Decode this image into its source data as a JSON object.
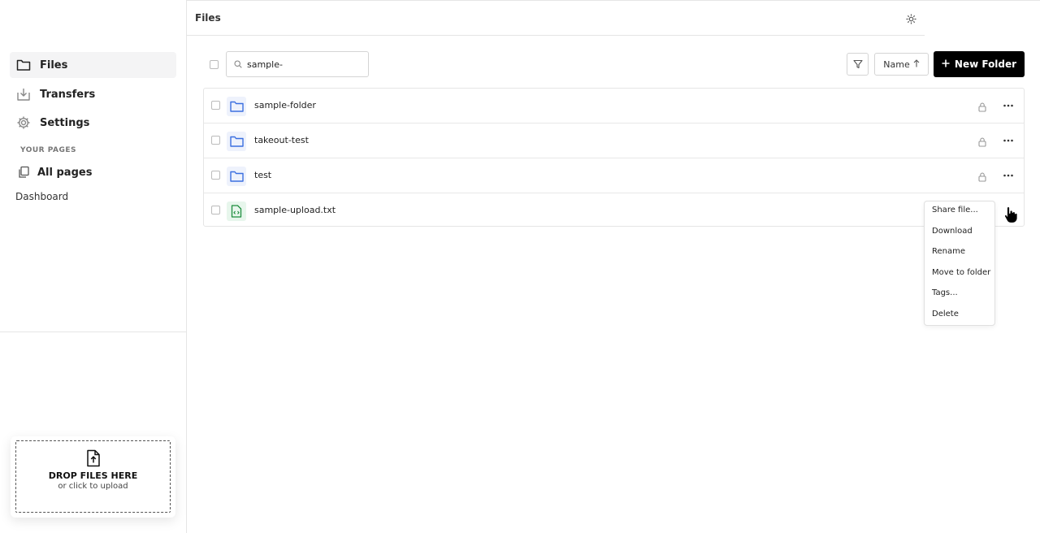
{
  "header": {
    "title": "Files"
  },
  "sidebar": {
    "items": [
      {
        "label": "Files",
        "icon": "folder-icon",
        "active": true
      },
      {
        "label": "Transfers",
        "icon": "inbox-download-icon"
      },
      {
        "label": "Settings",
        "icon": "gear-icon"
      }
    ],
    "section_label": "YOUR PAGES",
    "all_pages": {
      "label": "All pages",
      "icon": "copy-pages-icon"
    },
    "dashboard": "Dashboard"
  },
  "upload": {
    "title": "DROP FILES HERE",
    "subtitle": "or click to upload"
  },
  "toolbar": {
    "search_value": "sample-",
    "sort_label": "Name",
    "new_folder_label": "New Folder"
  },
  "files": [
    {
      "name": "sample-folder",
      "type": "folder",
      "locked": true
    },
    {
      "name": "takeout-test",
      "type": "folder",
      "locked": true
    },
    {
      "name": "test",
      "type": "folder",
      "locked": true
    },
    {
      "name": "sample-upload.txt",
      "type": "file",
      "locked": false
    }
  ],
  "context_menu": {
    "items": [
      "Share file...",
      "Download",
      "Rename",
      "Move to folder",
      "Tags...",
      "Delete"
    ]
  },
  "colors": {
    "accent": "#000000",
    "folder": "#3b6fe0",
    "file": "#1e8e3e"
  }
}
